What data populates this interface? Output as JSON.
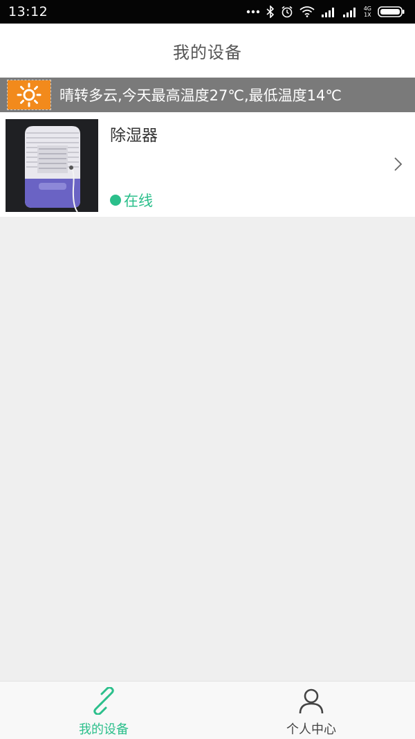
{
  "status_bar": {
    "time": "13:12",
    "network_top": "4G",
    "network_bottom": "1X"
  },
  "header": {
    "title": "我的设备"
  },
  "weather": {
    "icon": "sun-icon",
    "text": "晴转多云,今天最高温度27℃,最低温度14℃",
    "icon_bg": "#f28a1c"
  },
  "devices": [
    {
      "name": "除湿器",
      "status": "在线",
      "status_color": "#2bbf8b"
    }
  ],
  "bottom_nav": {
    "tabs": [
      {
        "label": "我的设备",
        "icon": "link-icon",
        "active": true,
        "color": "#2bbf8b"
      },
      {
        "label": "个人中心",
        "icon": "user-icon",
        "active": false,
        "color": "#444444"
      }
    ]
  }
}
